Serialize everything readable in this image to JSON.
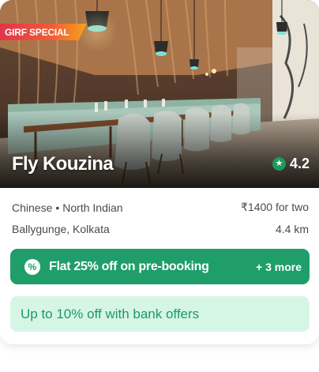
{
  "restaurant": {
    "special_tag": "GIRF SPECIAL",
    "name": "Fly Kouzina",
    "rating": "4.2",
    "cuisines": [
      "Chinese",
      "North Indian"
    ],
    "cuisine_separator": "•",
    "price": "₹1400 for two",
    "location": "Ballygunge, Kolkata",
    "distance": "4.4 km"
  },
  "offers": {
    "primary_text": "Flat 25% off on pre-booking",
    "primary_more": "+ 3 more",
    "primary_icon": "%",
    "bank_text": "Up to 10% off with bank offers"
  },
  "icons": {
    "rating": "star-icon",
    "offer": "discount-icon"
  },
  "colors": {
    "offer_green": "#1f9e6a",
    "offer_bank_bg": "#d6f6e5",
    "offer_bank_text": "#1b9a5e",
    "rating_badge": "#1a9b5a",
    "tag_gradient_start": "#e2334a",
    "tag_gradient_end": "#f7a21b"
  }
}
